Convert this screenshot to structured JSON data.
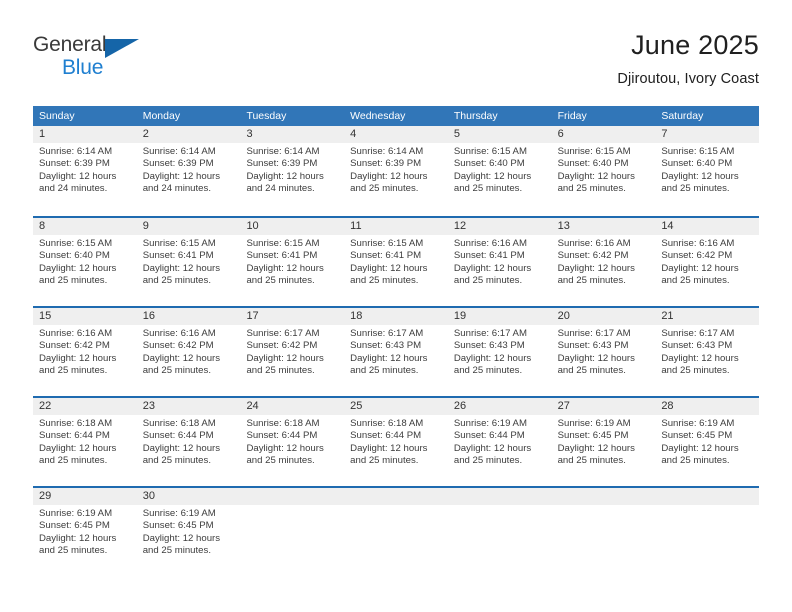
{
  "brand": {
    "name_line1": "General",
    "name_line2": "Blue",
    "triangle_icon": "triangle-icon",
    "color_dark": "#3a3a3a",
    "color_blue": "#1f7fd0",
    "color_triangle": "#1565a8"
  },
  "header": {
    "title": "June 2025",
    "subtitle": "Djiroutou, Ivory Coast"
  },
  "theme": {
    "header_row_bg": "#3176b8",
    "week_separator": "#1f6bb0",
    "daynum_band_bg": "#efefef",
    "text": "#3d3d3d"
  },
  "calendar": {
    "weekdays": [
      "Sunday",
      "Monday",
      "Tuesday",
      "Wednesday",
      "Thursday",
      "Friday",
      "Saturday"
    ],
    "weeks": [
      [
        {
          "day": "1",
          "lines": [
            "Sunrise: 6:14 AM",
            "Sunset: 6:39 PM",
            "Daylight: 12 hours",
            "and 24 minutes."
          ]
        },
        {
          "day": "2",
          "lines": [
            "Sunrise: 6:14 AM",
            "Sunset: 6:39 PM",
            "Daylight: 12 hours",
            "and 24 minutes."
          ]
        },
        {
          "day": "3",
          "lines": [
            "Sunrise: 6:14 AM",
            "Sunset: 6:39 PM",
            "Daylight: 12 hours",
            "and 24 minutes."
          ]
        },
        {
          "day": "4",
          "lines": [
            "Sunrise: 6:14 AM",
            "Sunset: 6:39 PM",
            "Daylight: 12 hours",
            "and 25 minutes."
          ]
        },
        {
          "day": "5",
          "lines": [
            "Sunrise: 6:15 AM",
            "Sunset: 6:40 PM",
            "Daylight: 12 hours",
            "and 25 minutes."
          ]
        },
        {
          "day": "6",
          "lines": [
            "Sunrise: 6:15 AM",
            "Sunset: 6:40 PM",
            "Daylight: 12 hours",
            "and 25 minutes."
          ]
        },
        {
          "day": "7",
          "lines": [
            "Sunrise: 6:15 AM",
            "Sunset: 6:40 PM",
            "Daylight: 12 hours",
            "and 25 minutes."
          ]
        }
      ],
      [
        {
          "day": "8",
          "lines": [
            "Sunrise: 6:15 AM",
            "Sunset: 6:40 PM",
            "Daylight: 12 hours",
            "and 25 minutes."
          ]
        },
        {
          "day": "9",
          "lines": [
            "Sunrise: 6:15 AM",
            "Sunset: 6:41 PM",
            "Daylight: 12 hours",
            "and 25 minutes."
          ]
        },
        {
          "day": "10",
          "lines": [
            "Sunrise: 6:15 AM",
            "Sunset: 6:41 PM",
            "Daylight: 12 hours",
            "and 25 minutes."
          ]
        },
        {
          "day": "11",
          "lines": [
            "Sunrise: 6:15 AM",
            "Sunset: 6:41 PM",
            "Daylight: 12 hours",
            "and 25 minutes."
          ]
        },
        {
          "day": "12",
          "lines": [
            "Sunrise: 6:16 AM",
            "Sunset: 6:41 PM",
            "Daylight: 12 hours",
            "and 25 minutes."
          ]
        },
        {
          "day": "13",
          "lines": [
            "Sunrise: 6:16 AM",
            "Sunset: 6:42 PM",
            "Daylight: 12 hours",
            "and 25 minutes."
          ]
        },
        {
          "day": "14",
          "lines": [
            "Sunrise: 6:16 AM",
            "Sunset: 6:42 PM",
            "Daylight: 12 hours",
            "and 25 minutes."
          ]
        }
      ],
      [
        {
          "day": "15",
          "lines": [
            "Sunrise: 6:16 AM",
            "Sunset: 6:42 PM",
            "Daylight: 12 hours",
            "and 25 minutes."
          ]
        },
        {
          "day": "16",
          "lines": [
            "Sunrise: 6:16 AM",
            "Sunset: 6:42 PM",
            "Daylight: 12 hours",
            "and 25 minutes."
          ]
        },
        {
          "day": "17",
          "lines": [
            "Sunrise: 6:17 AM",
            "Sunset: 6:42 PM",
            "Daylight: 12 hours",
            "and 25 minutes."
          ]
        },
        {
          "day": "18",
          "lines": [
            "Sunrise: 6:17 AM",
            "Sunset: 6:43 PM",
            "Daylight: 12 hours",
            "and 25 minutes."
          ]
        },
        {
          "day": "19",
          "lines": [
            "Sunrise: 6:17 AM",
            "Sunset: 6:43 PM",
            "Daylight: 12 hours",
            "and 25 minutes."
          ]
        },
        {
          "day": "20",
          "lines": [
            "Sunrise: 6:17 AM",
            "Sunset: 6:43 PM",
            "Daylight: 12 hours",
            "and 25 minutes."
          ]
        },
        {
          "day": "21",
          "lines": [
            "Sunrise: 6:17 AM",
            "Sunset: 6:43 PM",
            "Daylight: 12 hours",
            "and 25 minutes."
          ]
        }
      ],
      [
        {
          "day": "22",
          "lines": [
            "Sunrise: 6:18 AM",
            "Sunset: 6:44 PM",
            "Daylight: 12 hours",
            "and 25 minutes."
          ]
        },
        {
          "day": "23",
          "lines": [
            "Sunrise: 6:18 AM",
            "Sunset: 6:44 PM",
            "Daylight: 12 hours",
            "and 25 minutes."
          ]
        },
        {
          "day": "24",
          "lines": [
            "Sunrise: 6:18 AM",
            "Sunset: 6:44 PM",
            "Daylight: 12 hours",
            "and 25 minutes."
          ]
        },
        {
          "day": "25",
          "lines": [
            "Sunrise: 6:18 AM",
            "Sunset: 6:44 PM",
            "Daylight: 12 hours",
            "and 25 minutes."
          ]
        },
        {
          "day": "26",
          "lines": [
            "Sunrise: 6:19 AM",
            "Sunset: 6:44 PM",
            "Daylight: 12 hours",
            "and 25 minutes."
          ]
        },
        {
          "day": "27",
          "lines": [
            "Sunrise: 6:19 AM",
            "Sunset: 6:45 PM",
            "Daylight: 12 hours",
            "and 25 minutes."
          ]
        },
        {
          "day": "28",
          "lines": [
            "Sunrise: 6:19 AM",
            "Sunset: 6:45 PM",
            "Daylight: 12 hours",
            "and 25 minutes."
          ]
        }
      ],
      [
        {
          "day": "29",
          "lines": [
            "Sunrise: 6:19 AM",
            "Sunset: 6:45 PM",
            "Daylight: 12 hours",
            "and 25 minutes."
          ]
        },
        {
          "day": "30",
          "lines": [
            "Sunrise: 6:19 AM",
            "Sunset: 6:45 PM",
            "Daylight: 12 hours",
            "and 25 minutes."
          ]
        },
        {
          "day": "",
          "lines": []
        },
        {
          "day": "",
          "lines": []
        },
        {
          "day": "",
          "lines": []
        },
        {
          "day": "",
          "lines": []
        },
        {
          "day": "",
          "lines": []
        }
      ]
    ]
  }
}
